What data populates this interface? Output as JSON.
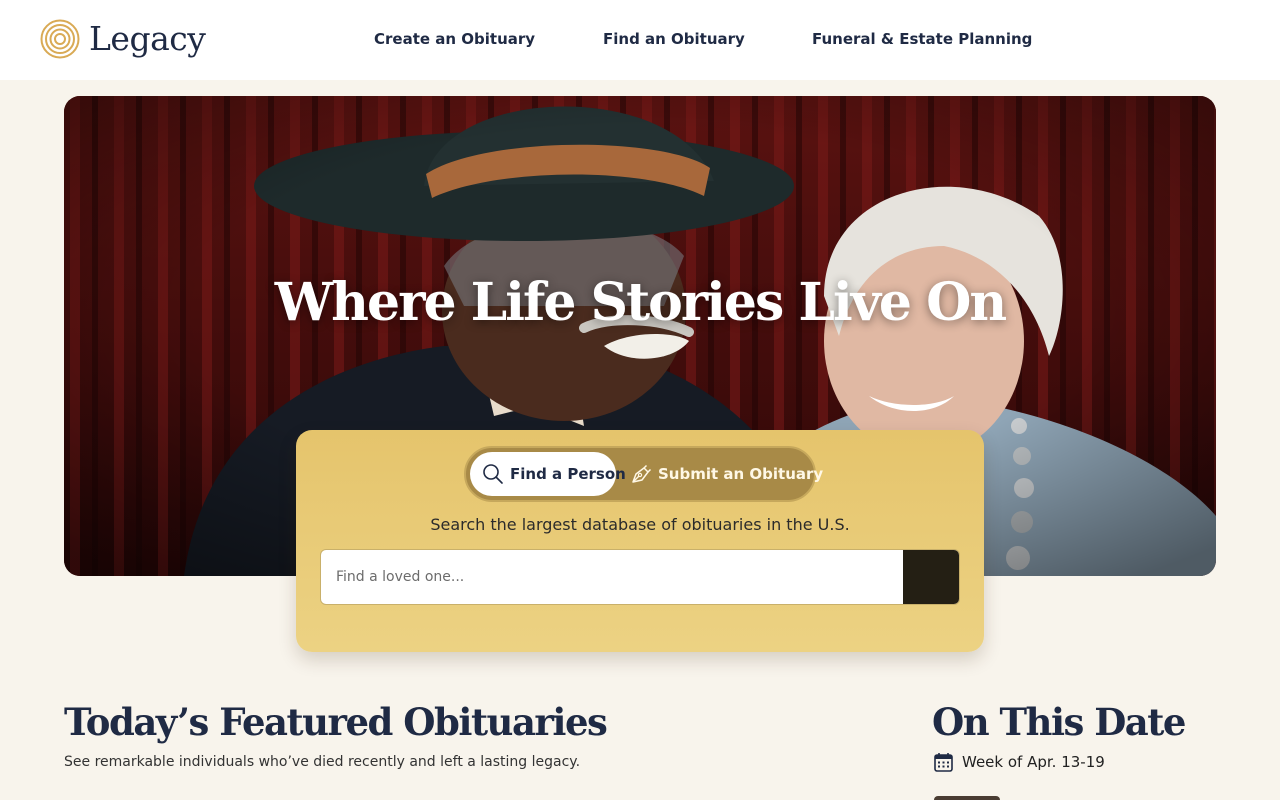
{
  "header": {
    "logo_text": "Legacy",
    "nav": {
      "create": "Create an Obituary",
      "find": "Find an Obituary",
      "funeral": "Funeral & Estate Planning"
    }
  },
  "hero": {
    "title": "Where Life Stories Live On"
  },
  "search": {
    "tab_find": "Find a Person",
    "tab_submit": "Submit an Obituary",
    "active_tab": "Find a Person",
    "description": "Search the largest database of obituaries in the U.S.",
    "placeholder": "Find a loved one...",
    "value": ""
  },
  "featured": {
    "title": "Today’s Featured Obituaries",
    "subtitle": "See remarkable individuals who’ve died recently and left a lasting legacy."
  },
  "on_this_date": {
    "title": "On This Date",
    "week": "Week of Apr. 13-19"
  },
  "colors": {
    "navy": "#1f2a44",
    "gold": "#e5c46c",
    "background": "#f8f4ec",
    "search_button": "#241f14"
  },
  "icons": {
    "logo": "concentric-circles-logo-icon",
    "find_tab": "search-icon",
    "submit_tab": "pen-nib-icon",
    "week": "calendar-icon"
  }
}
